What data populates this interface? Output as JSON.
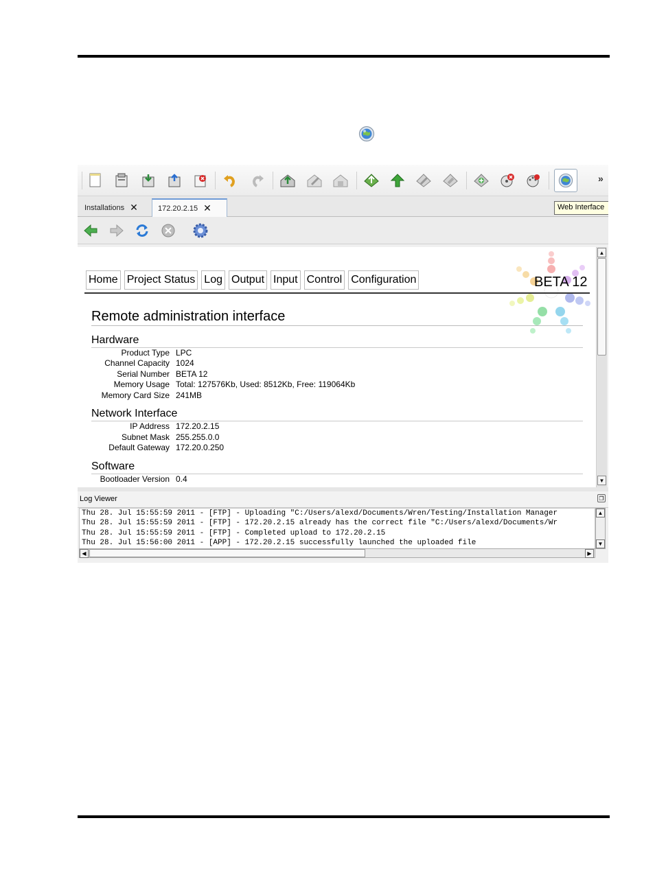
{
  "toolbar": {
    "icons": [
      "new-icon",
      "open-icon",
      "download-icon",
      "upload-icon",
      "delete-icon",
      "undo-icon",
      "redo-icon",
      "house-add-icon",
      "house-edit-icon",
      "house-remove-icon",
      "diamond-up-icon",
      "arrow-up-icon",
      "edit-up-icon",
      "tool-up-icon",
      "puzzle-icon",
      "dial-stop-icon",
      "dial-icon",
      "web-interface-icon"
    ],
    "more": "»",
    "tooltip": "Web Interface"
  },
  "tabs": [
    {
      "label": "Installations",
      "close": "✕"
    },
    {
      "label": "172.20.2.15",
      "close": "✕"
    }
  ],
  "nav": {
    "icons": [
      "back-icon",
      "forward-icon",
      "refresh-icon",
      "stop-icon",
      "settings-icon"
    ]
  },
  "web": {
    "menu": [
      "Home",
      "Project Status",
      "Log",
      "Output",
      "Input",
      "Control",
      "Configuration"
    ],
    "badge": "BETA 12",
    "title": "Remote administration interface",
    "sections": {
      "hardware": {
        "title": "Hardware",
        "rows": [
          {
            "k": "Product Type",
            "v": "LPC"
          },
          {
            "k": "Channel Capacity",
            "v": "1024"
          },
          {
            "k": "Serial Number",
            "v": "BETA 12"
          },
          {
            "k": "Memory Usage",
            "v": "Total: 127576Kb, Used: 8512Kb, Free: 119064Kb"
          },
          {
            "k": "Memory Card Size",
            "v": "241MB"
          }
        ]
      },
      "network": {
        "title": "Network Interface",
        "rows": [
          {
            "k": "IP Address",
            "v": "172.20.2.15"
          },
          {
            "k": "Subnet Mask",
            "v": "255.255.0.0"
          },
          {
            "k": "Default Gateway",
            "v": "172.20.0.250"
          }
        ]
      },
      "software": {
        "title": "Software",
        "rows": [
          {
            "k": "Bootloader Version",
            "v": "0.4"
          }
        ]
      }
    }
  },
  "log": {
    "title": "Log Viewer",
    "lines": [
      "Thu 28. Jul 15:55:59 2011 - [FTP] - Uploading \"C:/Users/alexd/Documents/Wren/Testing/Installation Manager",
      "Thu 28. Jul 15:55:59 2011 - [FTP] - 172.20.2.15 already has the correct file \"C:/Users/alexd/Documents/Wr",
      "Thu 28. Jul 15:55:59 2011 - [FTP] - Completed upload to 172.20.2.15",
      "Thu 28. Jul 15:56:00 2011 - [APP] - 172.20.2.15 successfully launched the uploaded file"
    ]
  }
}
